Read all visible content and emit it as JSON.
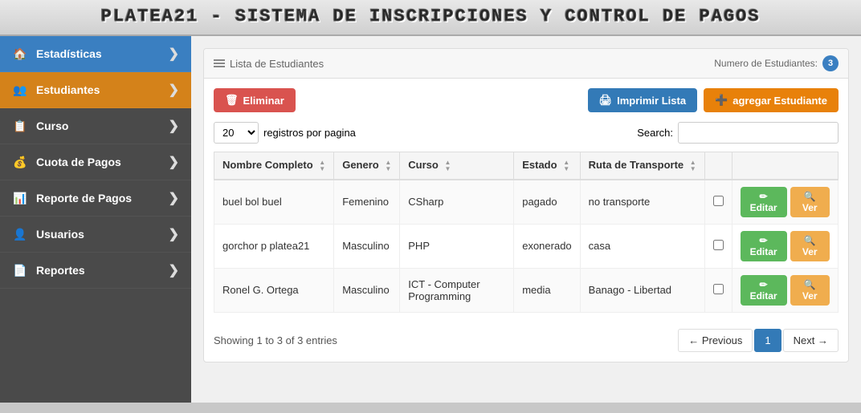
{
  "header": {
    "title": "PLATEA21 - SISTEMA DE INSCRIPCIONES Y CONTROL DE PAGOS"
  },
  "sidebar": {
    "items": [
      {
        "id": "estadisticas",
        "label": "Estadísticas",
        "icon": "home",
        "active": false,
        "style": "blue"
      },
      {
        "id": "estudiantes",
        "label": "Estudiantes",
        "icon": "users",
        "active": true,
        "style": "active"
      },
      {
        "id": "curso",
        "label": "Curso",
        "icon": "list",
        "active": false,
        "style": ""
      },
      {
        "id": "cuota-pagos",
        "label": "Cuota de Pagos",
        "icon": "coin",
        "active": false,
        "style": ""
      },
      {
        "id": "reporte-pagos",
        "label": "Reporte de Pagos",
        "icon": "table",
        "active": false,
        "style": ""
      },
      {
        "id": "usuarios",
        "label": "Usuarios",
        "icon": "people",
        "active": false,
        "style": ""
      },
      {
        "id": "reportes",
        "label": "Reportes",
        "icon": "file",
        "active": false,
        "style": ""
      }
    ]
  },
  "panel": {
    "title": "Lista de Estudiantes",
    "count_label": "Numero de Estudiantes:",
    "count": "3"
  },
  "toolbar": {
    "delete_label": "Eliminar",
    "print_label": "Imprimir Lista",
    "add_label": "agregar Estudiante"
  },
  "entries": {
    "per_page": "20",
    "per_page_label": "registros por pagina",
    "search_label": "Search:"
  },
  "table": {
    "columns": [
      {
        "label": "Nombre Completo",
        "sortable": true,
        "sort_asc": true
      },
      {
        "label": "Genero",
        "sortable": true,
        "sort_asc": false
      },
      {
        "label": "Curso",
        "sortable": true,
        "sort_asc": false
      },
      {
        "label": "Estado",
        "sortable": true,
        "sort_asc": false
      },
      {
        "label": "Ruta de Transporte",
        "sortable": true,
        "sort_asc": false
      },
      {
        "label": "",
        "sortable": false
      },
      {
        "label": "",
        "sortable": false
      }
    ],
    "rows": [
      {
        "nombre": "buel bol buel",
        "genero": "Femenino",
        "curso": "CSharp",
        "estado": "pagado",
        "ruta": "no transporte"
      },
      {
        "nombre": "gorchor p platea21",
        "genero": "Masculino",
        "curso": "PHP",
        "estado": "exonerado",
        "ruta": "casa"
      },
      {
        "nombre": "Ronel G. Ortega",
        "genero": "Masculino",
        "curso": "ICT - Computer Programming",
        "estado": "media",
        "ruta": "Banago - Libertad"
      }
    ],
    "edit_label": "Editar",
    "view_label": "Ver"
  },
  "pagination": {
    "showing_text": "Showing 1 to 3 of 3 entries",
    "previous_label": "← Previous",
    "current_page": "1",
    "next_label": "Next →"
  }
}
